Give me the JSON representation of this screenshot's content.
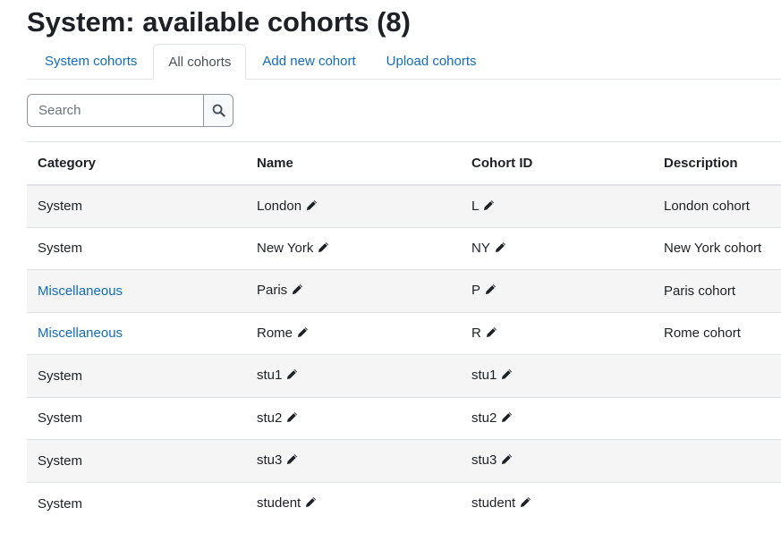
{
  "page": {
    "title": "System: available cohorts (8)"
  },
  "tabs": [
    {
      "label": "System cohorts",
      "active": false
    },
    {
      "label": "All cohorts",
      "active": true
    },
    {
      "label": "Add new cohort",
      "active": false
    },
    {
      "label": "Upload cohorts",
      "active": false
    }
  ],
  "search": {
    "placeholder": "Search",
    "value": "",
    "button_icon": "search-icon"
  },
  "table": {
    "headers": {
      "category": "Category",
      "name": "Name",
      "cohort_id": "Cohort ID",
      "description": "Description"
    },
    "rows": [
      {
        "category": "System",
        "category_link": false,
        "name": "London",
        "cohort_id": "L",
        "description": "London cohort"
      },
      {
        "category": "System",
        "category_link": false,
        "name": "New York",
        "cohort_id": "NY",
        "description": "New York cohort"
      },
      {
        "category": "Miscellaneous",
        "category_link": true,
        "name": "Paris",
        "cohort_id": "P",
        "description": "Paris cohort"
      },
      {
        "category": "Miscellaneous",
        "category_link": true,
        "name": "Rome",
        "cohort_id": "R",
        "description": "Rome cohort"
      },
      {
        "category": "System",
        "category_link": false,
        "name": "stu1",
        "cohort_id": "stu1",
        "description": ""
      },
      {
        "category": "System",
        "category_link": false,
        "name": "stu2",
        "cohort_id": "stu2",
        "description": ""
      },
      {
        "category": "System",
        "category_link": false,
        "name": "stu3",
        "cohort_id": "stu3",
        "description": ""
      },
      {
        "category": "System",
        "category_link": false,
        "name": "student",
        "cohort_id": "student",
        "description": ""
      }
    ]
  },
  "icons": {
    "edit": "pencil-icon",
    "search": "search-icon"
  },
  "colors": {
    "link": "#0f6cbf",
    "text": "#1d2125",
    "stripe": "#f5f5f5",
    "border": "#dee2e6"
  }
}
